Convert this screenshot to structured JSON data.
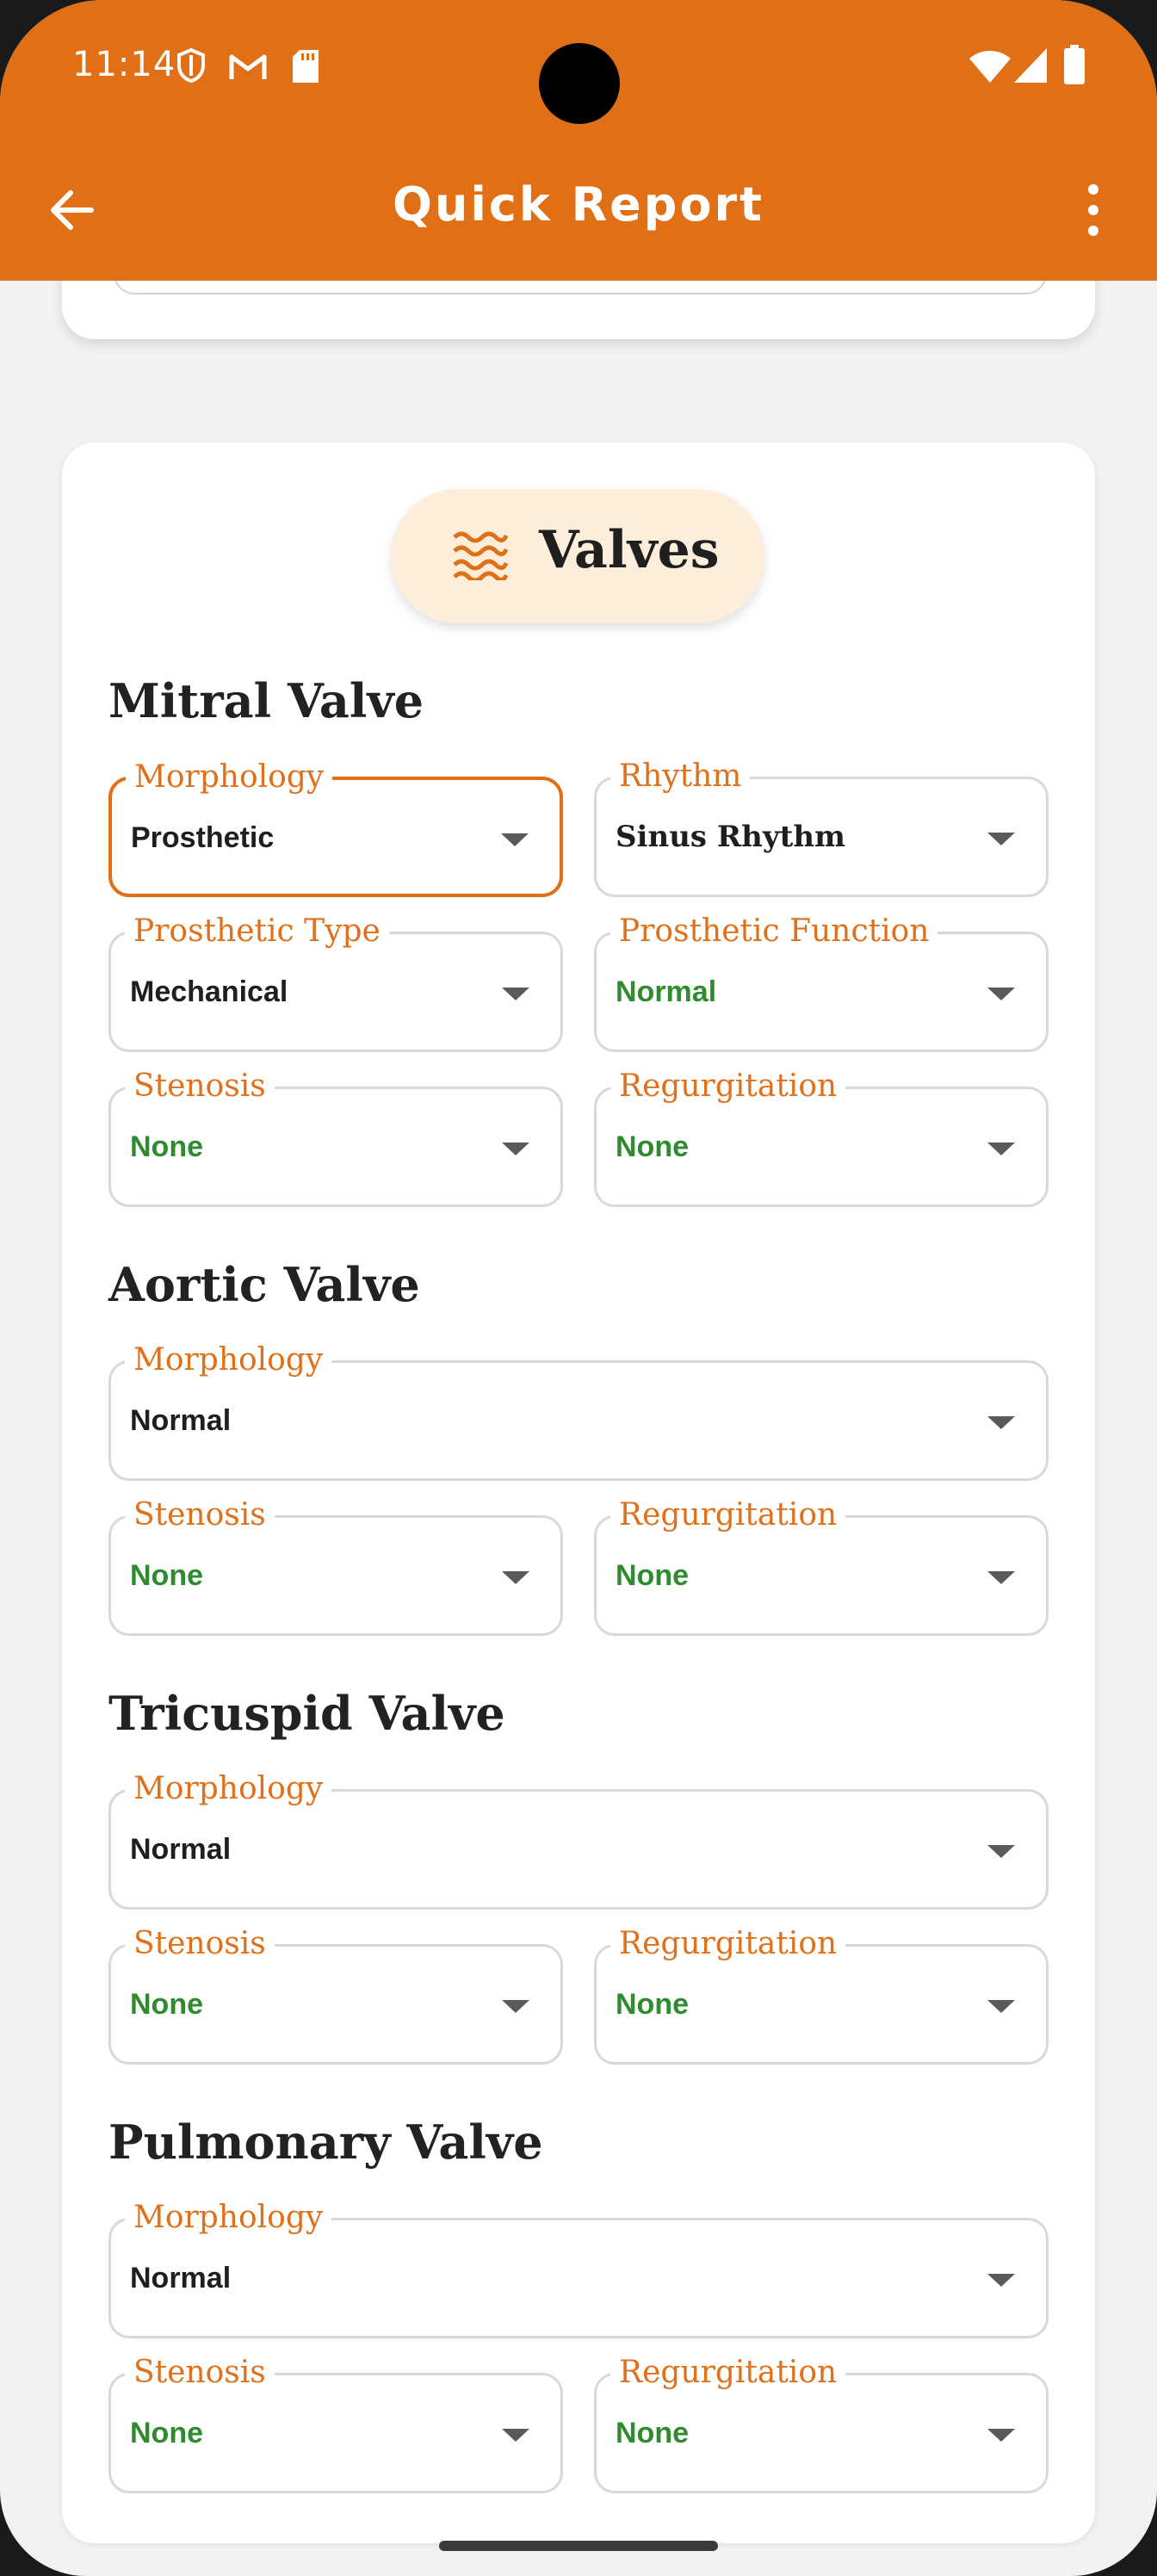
{
  "status_bar": {
    "time": "11:14"
  },
  "app_bar": {
    "title": "Quick Report"
  },
  "section": {
    "title": "Valves"
  },
  "colors": {
    "accent": "#e06f16",
    "value_green": "#2e8b2e",
    "pill_bg": "#fdeedb"
  },
  "mitral": {
    "title": "Mitral Valve",
    "morphology_label": "Morphology",
    "morphology_value": "Prosthetic",
    "rhythm_label": "Rhythm",
    "rhythm_value": "Sinus Rhythm",
    "prosthetic_type_label": "Prosthetic Type",
    "prosthetic_type_value": "Mechanical",
    "prosthetic_function_label": "Prosthetic Function",
    "prosthetic_function_value": "Normal",
    "stenosis_label": "Stenosis",
    "stenosis_value": "None",
    "regurgitation_label": "Regurgitation",
    "regurgitation_value": "None"
  },
  "aortic": {
    "title": "Aortic Valve",
    "morphology_label": "Morphology",
    "morphology_value": "Normal",
    "stenosis_label": "Stenosis",
    "stenosis_value": "None",
    "regurgitation_label": "Regurgitation",
    "regurgitation_value": "None"
  },
  "tricuspid": {
    "title": "Tricuspid Valve",
    "morphology_label": "Morphology",
    "morphology_value": "Normal",
    "stenosis_label": "Stenosis",
    "stenosis_value": "None",
    "regurgitation_label": "Regurgitation",
    "regurgitation_value": "None"
  },
  "pulmonary": {
    "title": "Pulmonary Valve",
    "morphology_label": "Morphology",
    "morphology_value": "Normal",
    "stenosis_label": "Stenosis",
    "stenosis_value": "None",
    "regurgitation_label": "Regurgitation",
    "regurgitation_value": "None"
  }
}
